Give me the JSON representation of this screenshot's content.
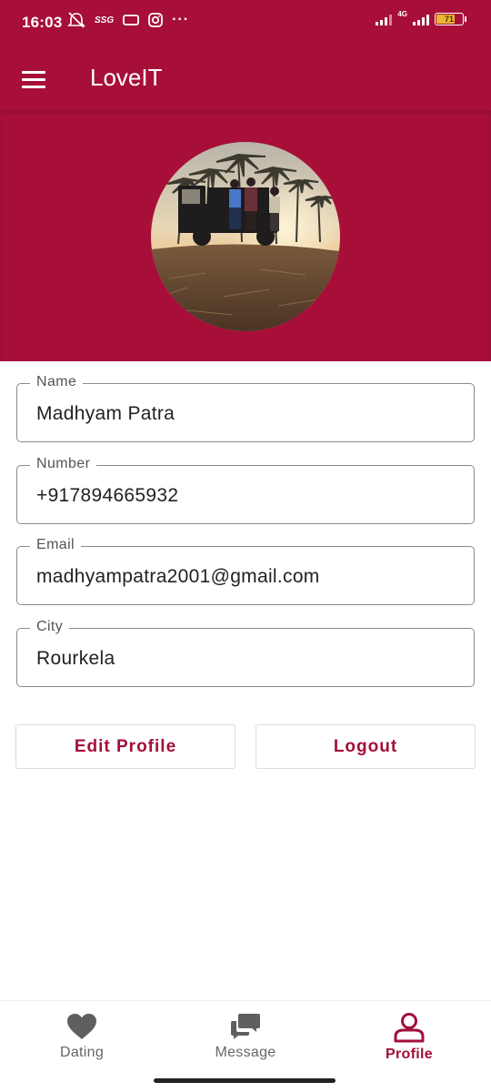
{
  "status_bar": {
    "time": "16:03",
    "network_label": "4G",
    "battery_level": "71",
    "battery_fraction": 0.71,
    "carrier_tag": "SSG",
    "overflow": "···"
  },
  "app_bar": {
    "title": "LoveIT",
    "menu_icon": "hamburger-menu-icon"
  },
  "profile": {
    "avatar_icon": "profile-photo"
  },
  "fields": {
    "name": {
      "label": "Name",
      "value": "Madhyam Patra"
    },
    "number": {
      "label": "Number",
      "value": "+917894665932"
    },
    "email": {
      "label": "Email",
      "value": "madhyampatra2001@gmail.com"
    },
    "city": {
      "label": "City",
      "value": "Rourkela"
    }
  },
  "actions": {
    "edit_label": "Edit Profile",
    "logout_label": "Logout"
  },
  "bottom_nav": {
    "items": [
      {
        "label": "Dating",
        "icon": "heart-icon",
        "active": false
      },
      {
        "label": "Message",
        "icon": "chat-bubbles-icon",
        "active": false
      },
      {
        "label": "Profile",
        "icon": "person-icon",
        "active": true
      }
    ]
  },
  "colors": {
    "brand": "#a70f39",
    "accent_text": "#a30f3a",
    "inactive_icon": "#5f5f5f"
  }
}
